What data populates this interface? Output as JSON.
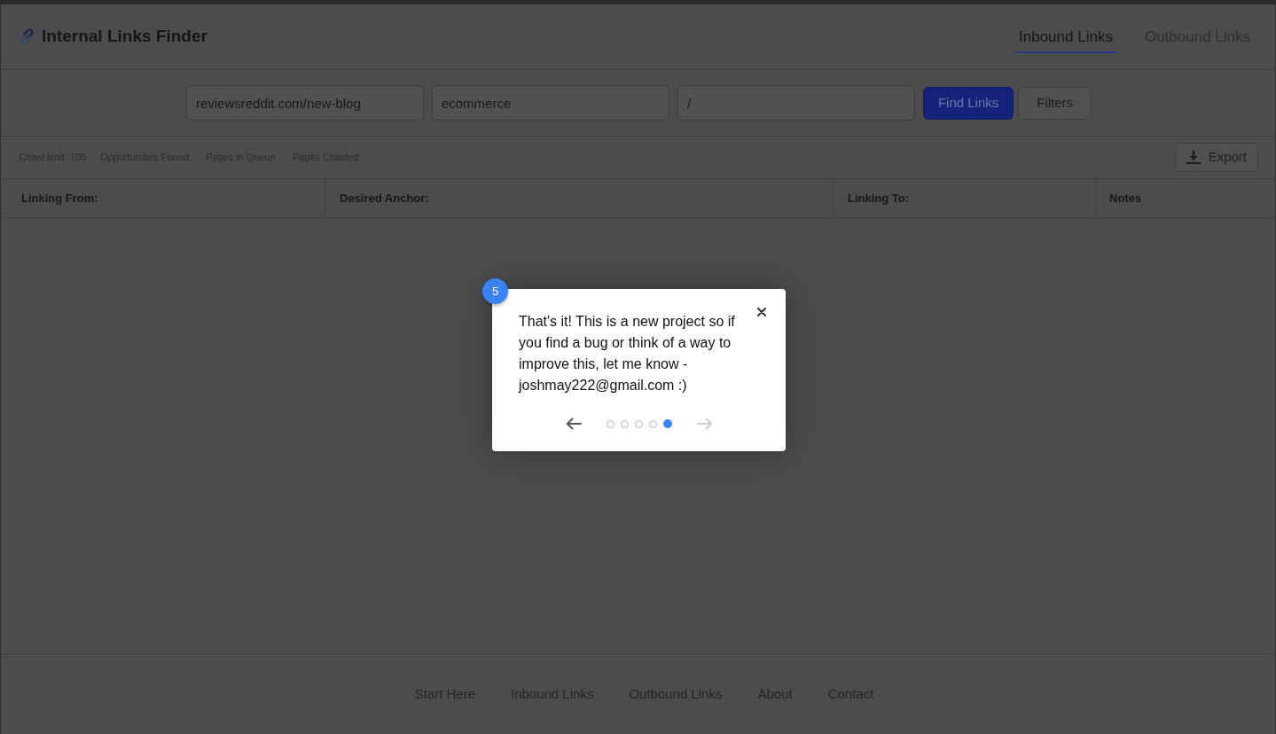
{
  "header": {
    "title": "Internal Links Finder",
    "tabs": [
      {
        "label": "Inbound Links",
        "selected": true
      },
      {
        "label": "Outbound Links",
        "selected": false
      }
    ]
  },
  "search": {
    "fields": [
      {
        "value": "reviewsreddit.com/new-blog"
      },
      {
        "value": "ecommerce"
      },
      {
        "value": "/"
      }
    ],
    "buttons": [
      {
        "label": "Find Links",
        "kind": "primary"
      },
      {
        "label": "Filters",
        "kind": "secondary"
      }
    ]
  },
  "stats": [
    "Crawl limit: 100",
    "Opportunities Found:",
    "Pages in Queue:",
    "Pages Crawled:"
  ],
  "export_button": {
    "label": "Export"
  },
  "table": {
    "columns": [
      "Linking From:",
      "Desired Anchor:",
      "Linking To:",
      "Notes"
    ]
  },
  "tour": {
    "step": "5",
    "text": "That's it! This is a new project so if you find a bug or think of a way to improve this, let me know - joshmay222@gmail.com :)",
    "previous_disabled": false,
    "next_disabled": true,
    "steps": [
      {
        "selected": false
      },
      {
        "selected": false
      },
      {
        "selected": false
      },
      {
        "selected": false
      },
      {
        "selected": true
      }
    ]
  },
  "footer": {
    "links": [
      "Start Here",
      "Inbound Links",
      "Outbound Links",
      "About",
      "Contact"
    ]
  }
}
